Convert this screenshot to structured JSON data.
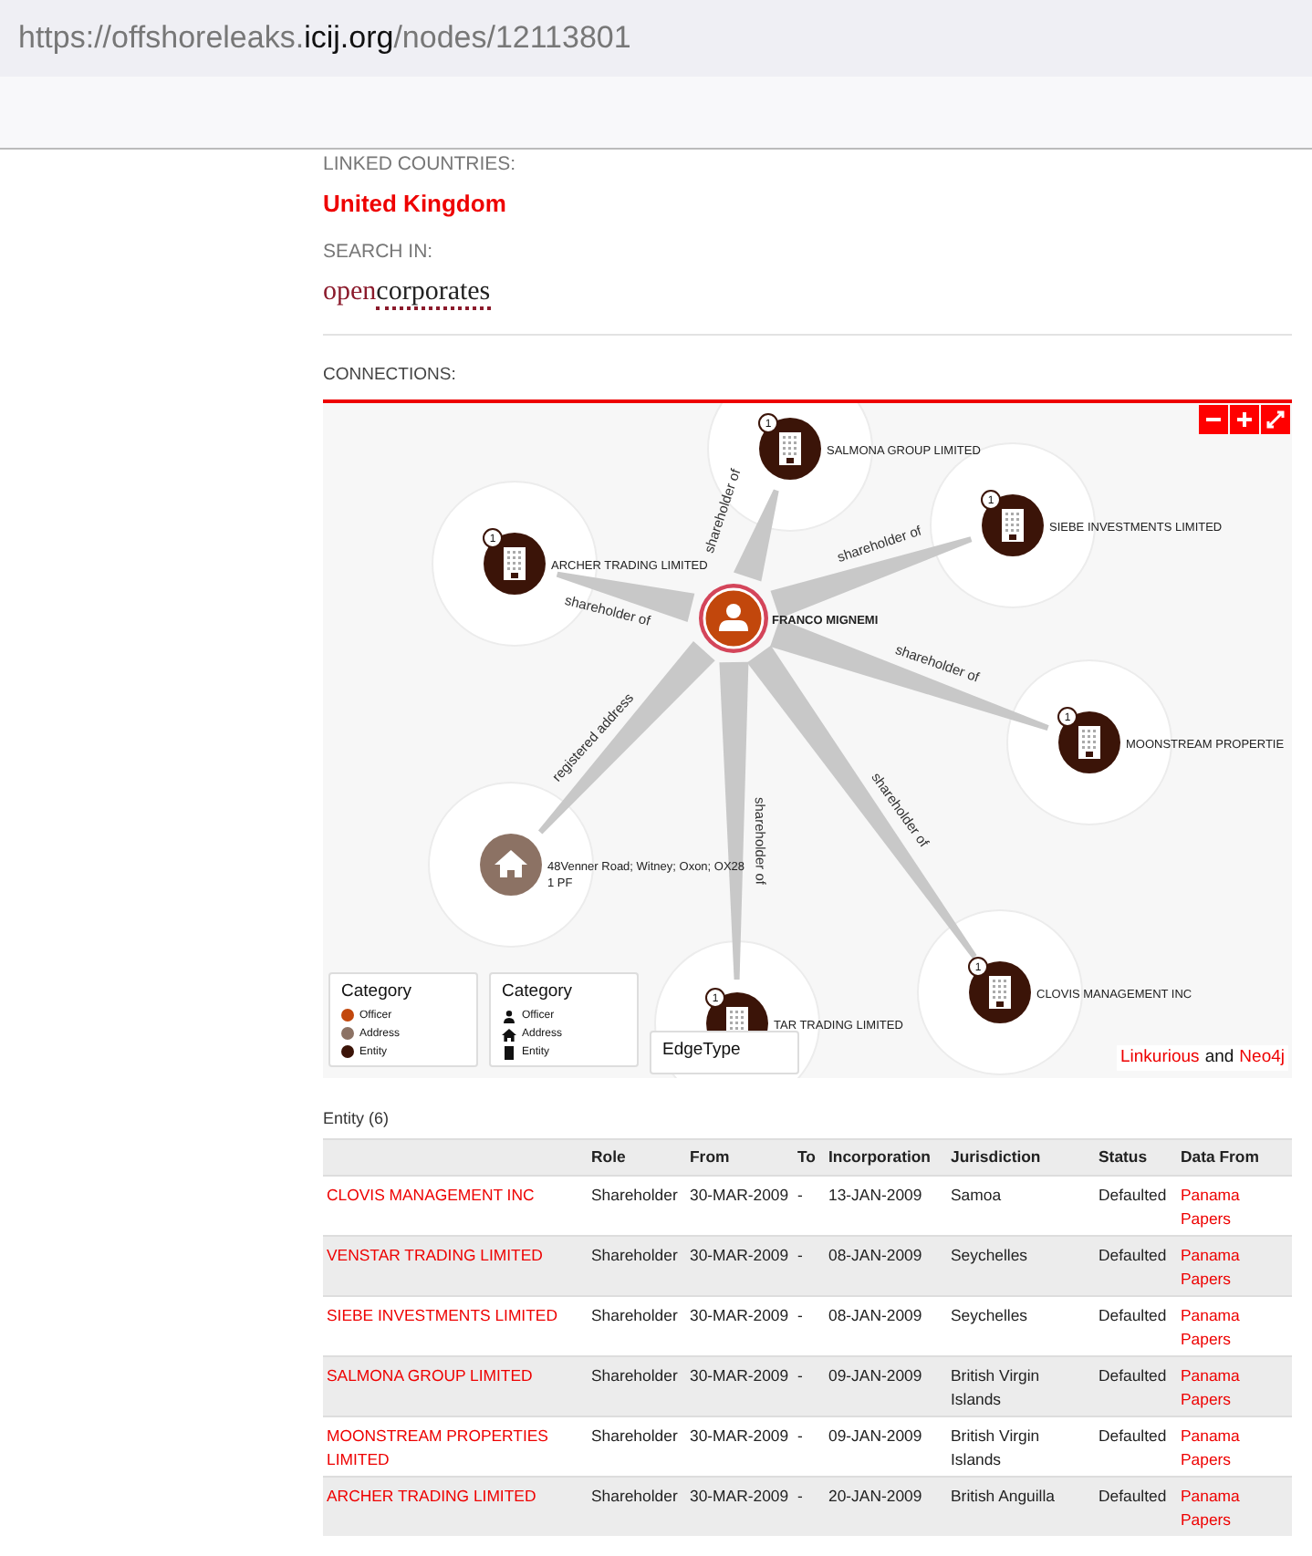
{
  "browser": {
    "url_prefix": "https://offshoreleaks.",
    "url_domain": "icij.org",
    "url_suffix": "/nodes/12113801"
  },
  "linked_countries": {
    "label": "LINKED COUNTRIES:",
    "value": "United Kingdom"
  },
  "search_in": {
    "label": "SEARCH IN:",
    "logo_parts": [
      "open",
      "corporates"
    ]
  },
  "connections": {
    "label": "CONNECTIONS:",
    "graph": {
      "nodes": [
        {
          "kind": "entity",
          "label": "SALMONA GROUP LIMITED",
          "badge": "1"
        },
        {
          "kind": "entity",
          "label": "SIEBE INVESTMENTS LIMITED",
          "badge": "1"
        },
        {
          "kind": "entity",
          "label": "ARCHER TRADING LIMITED",
          "badge": "1"
        },
        {
          "kind": "entity",
          "label": "MOONSTREAM PROPERTIE",
          "badge": "1"
        },
        {
          "kind": "address",
          "label": "48Venner Road; Witney; Oxon; OX28",
          "label_2": "1 PF"
        },
        {
          "kind": "entity",
          "label": "TAR TRADING LIMITED",
          "badge": "1"
        },
        {
          "kind": "entity",
          "label": "CLOVIS MANAGEMENT INC",
          "badge": "1"
        },
        {
          "kind": "officer",
          "label": "FRANCO MIGNEMI"
        }
      ],
      "edges": [
        {
          "label": "shareholder of"
        },
        {
          "label": "shareholder of"
        },
        {
          "label": "shareholder of"
        },
        {
          "label": "shareholder of"
        },
        {
          "label": "registered address"
        },
        {
          "label": "shareholder of"
        },
        {
          "label": "shareholder of"
        }
      ],
      "controls": [
        {
          "kind": "zoom_out"
        },
        {
          "kind": "zoom_in"
        },
        {
          "kind": "fullscreen"
        }
      ],
      "legends": [
        {
          "title": "Category",
          "kind": "color",
          "items": [
            {
              "label": "Officer",
              "color": "#c2470c"
            },
            {
              "label": "Address",
              "color": "#8c7264"
            },
            {
              "label": "Entity",
              "color": "#3b1408"
            }
          ]
        },
        {
          "title": "Category",
          "kind": "icon",
          "items": [
            {
              "label": "Officer"
            },
            {
              "label": "Address"
            },
            {
              "label": "Entity"
            }
          ]
        },
        {
          "title": "EdgeType",
          "kind": "empty"
        }
      ],
      "credit": {
        "link_1": "Linkurious",
        "joiner": "and",
        "link_2": "Neo4j"
      }
    }
  },
  "table": {
    "caption": "Entity (6)",
    "columns": [
      "",
      "Role",
      "From",
      "To",
      "Incorporation",
      "Jurisdiction",
      "Status",
      "Data From"
    ],
    "rows": [
      [
        "CLOVIS MANAGEMENT INC",
        "Shareholder",
        "30-MAR-2009",
        "-",
        "13-JAN-2009",
        "Samoa",
        "Defaulted",
        "Panama Papers"
      ],
      [
        "VENSTAR TRADING LIMITED",
        "Shareholder",
        "30-MAR-2009",
        "-",
        "08-JAN-2009",
        "Seychelles",
        "Defaulted",
        "Panama Papers"
      ],
      [
        "SIEBE INVESTMENTS LIMITED",
        "Shareholder",
        "30-MAR-2009",
        "-",
        "08-JAN-2009",
        "Seychelles",
        "Defaulted",
        "Panama Papers"
      ],
      [
        "SALMONA GROUP LIMITED",
        "Shareholder",
        "30-MAR-2009",
        "-",
        "09-JAN-2009",
        "British Virgin Islands",
        "Defaulted",
        "Panama Papers"
      ],
      [
        "MOONSTREAM PROPERTIES LIMITED",
        "Shareholder",
        "30-MAR-2009",
        "-",
        "09-JAN-2009",
        "British Virgin Islands",
        "Defaulted",
        "Panama Papers"
      ],
      [
        "ARCHER TRADING LIMITED",
        "Shareholder",
        "30-MAR-2009",
        "-",
        "20-JAN-2009",
        "British Anguilla",
        "Defaulted",
        "Panama Papers"
      ]
    ]
  }
}
